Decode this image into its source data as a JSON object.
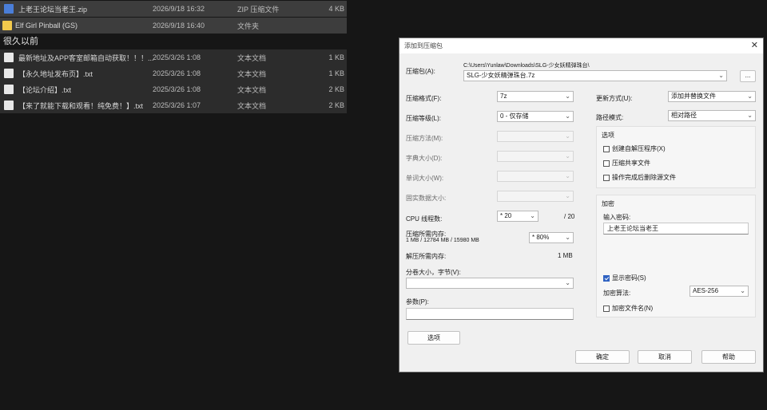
{
  "explorer": {
    "rows": [
      {
        "name": "上老王论坛当老王.zip",
        "date": "2026/9/18 16:32",
        "type": "ZIP 压缩文件",
        "size": "4 KB"
      },
      {
        "name": "Elf Girl Pinball (GS)",
        "date": "2026/9/18 16:40",
        "type": "文件夹",
        "size": ""
      }
    ],
    "group_label": "很久以前",
    "old_rows": [
      {
        "name": "最新地址及APP客室邮箱自动获取！！！...",
        "date": "2025/3/26 1:08",
        "type": "文本文档",
        "size": "1 KB"
      },
      {
        "name": "【永久地址发布页】.txt",
        "date": "2025/3/26 1:08",
        "type": "文本文档",
        "size": "1 KB"
      },
      {
        "name": "【论坛介绍】.txt",
        "date": "2025/3/26 1:08",
        "type": "文本文档",
        "size": "2 KB"
      },
      {
        "name": "【来了就能下载和观看！纯免费！】.txt",
        "date": "2025/3/26 1:07",
        "type": "文本文档",
        "size": "2 KB"
      }
    ]
  },
  "dialog": {
    "title": "添加到压缩包",
    "close": "✕",
    "archive_label": "压缩包(A):",
    "archive_path": "C:\\Users\\Yunlaw\\Downloads\\SLG-少女妖精弹珠台\\",
    "archive_name": "SLG-少女妖精弹珠台.7z",
    "browse": "...",
    "format_label": "压缩格式(F):",
    "format_value": "7z",
    "level_label": "压缩等级(L):",
    "level_value": "0 - 仅存储",
    "method_label": "压缩方法(M):",
    "dict_label": "字典大小(D):",
    "word_label": "单词大小(W):",
    "solid_label": "固实数据大小:",
    "cpu_label": "CPU 线程数:",
    "cpu_value": "* 20",
    "cpu_max": "/ 20",
    "mem_label": "压缩所需内存:",
    "mem_detail": "1 MB / 12784 MB / 15980 MB",
    "mem_percent": "* 80%",
    "demem_label": "解压所需内存:",
    "demem_value": "1 MB",
    "split_label": "分卷大小，字节(V):",
    "params_label": "参数(P):",
    "options_btn": "选项",
    "update_label": "更新方式(U):",
    "update_value": "添加并替换文件",
    "path_label": "路径模式:",
    "path_value": "相对路径",
    "opt_group": "选项",
    "opt1": "创建自解压程序(X)",
    "opt2": "压缩共享文件",
    "opt3": "操作完成后删除源文件",
    "enc_group": "加密",
    "pwd_label": "输入密码:",
    "pwd_value": "上老王论坛当老王",
    "show_pwd": "显示密码(S)",
    "enc_method_label": "加密算法:",
    "enc_method_value": "AES-256",
    "enc_names": "加密文件名(N)",
    "ok": "确定",
    "cancel": "取消",
    "help": "帮助"
  }
}
